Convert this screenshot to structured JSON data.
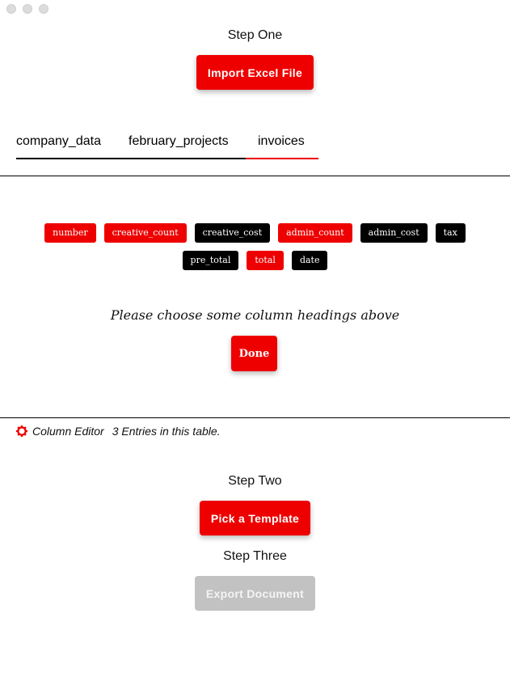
{
  "window": {
    "controls": [
      "close",
      "minimize",
      "zoom"
    ]
  },
  "step_one": {
    "label": "Step One",
    "import_button": "Import Excel File"
  },
  "tabs": [
    {
      "label": "company_data",
      "active": false
    },
    {
      "label": "february_projects",
      "active": false
    },
    {
      "label": "invoices",
      "active": true
    }
  ],
  "columns": [
    {
      "label": "number",
      "selected": true
    },
    {
      "label": "creative_count",
      "selected": true
    },
    {
      "label": "creative_cost",
      "selected": false
    },
    {
      "label": "admin_count",
      "selected": true
    },
    {
      "label": "admin_cost",
      "selected": false
    },
    {
      "label": "tax",
      "selected": false
    },
    {
      "label": "pre_total",
      "selected": false
    },
    {
      "label": "total",
      "selected": true
    },
    {
      "label": "date",
      "selected": false
    }
  ],
  "prompt": "Please choose some column headings above",
  "done_button": "Done",
  "status": {
    "icon": "gear-icon",
    "editor_label": "Column Editor",
    "entries_text": "3 Entries in this table."
  },
  "step_two": {
    "label": "Step Two",
    "template_button": "Pick a Template"
  },
  "step_three": {
    "label": "Step Three",
    "export_button": "Export Document",
    "export_enabled": false
  },
  "colors": {
    "accent": "#ee0000",
    "chip_dark": "#000000",
    "disabled": "#c2c2c2"
  }
}
